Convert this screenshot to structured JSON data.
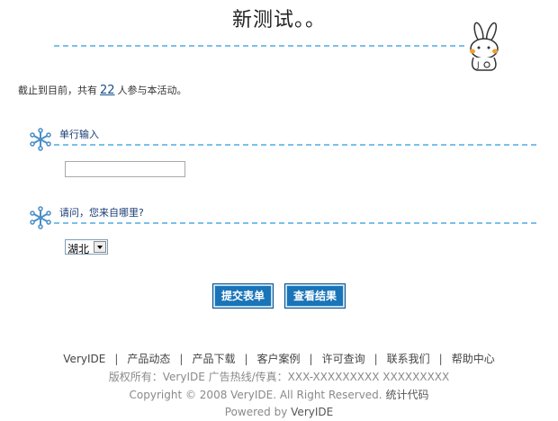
{
  "page": {
    "title": "新测试。。"
  },
  "summary": {
    "prefix": "截止到目前，共有",
    "count": "22",
    "suffix": "人参与本活动。"
  },
  "questions": [
    {
      "label": "单行输入",
      "input_value": ""
    },
    {
      "label": "请问，您来自哪里?",
      "selected": "湖北"
    }
  ],
  "buttons": {
    "submit": "提交表单",
    "results": "查看结果"
  },
  "footer": {
    "nav": [
      "VeryIDE",
      "产品动态",
      "产品下载",
      "客户案例",
      "许可查询",
      "联系我们",
      "帮助中心"
    ],
    "separator": "|",
    "contact": "版权所有：VeryIDE 广告热线/传真：XXX-XXXXXXXXX XXXXXXXXX",
    "copyright": "Copyright © 2008 VeryIDE. All Right Reserved.",
    "stats_link": "统计代码",
    "powered_prefix": "Powered by",
    "powered_brand": "VeryIDE"
  },
  "colors": {
    "dash": "#7cc0ea",
    "button_bg": "#1a74b8",
    "question_label": "#1a3c74"
  }
}
